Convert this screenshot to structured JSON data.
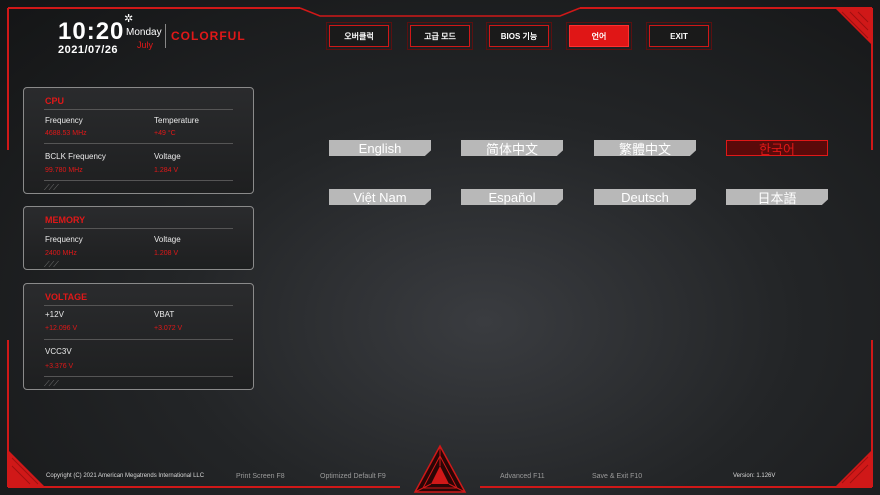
{
  "clock": {
    "time": "10:20",
    "date": "2021/07/26",
    "day": "Monday",
    "month": "July"
  },
  "brand": "COLORFUL",
  "tabs": [
    {
      "label": "오버클럭"
    },
    {
      "label": "고급 모드"
    },
    {
      "label": "BIOS 기능"
    },
    {
      "label": "언어"
    },
    {
      "label": "EXIT"
    }
  ],
  "cpu": {
    "title": "CPU",
    "frequency_label": "Frequency",
    "frequency_value": "4688.53 MHz",
    "temperature_label": "Temperature",
    "temperature_value": "+49 °C",
    "bclk_label": "BCLK Frequency",
    "bclk_value": "99.780 MHz",
    "voltage_label": "Voltage",
    "voltage_value": "1.284 V"
  },
  "memory": {
    "title": "MEMORY",
    "frequency_label": "Frequency",
    "frequency_value": "2400 MHz",
    "voltage_label": "Voltage",
    "voltage_value": "1.208 V"
  },
  "voltage": {
    "title": "VOLTAGE",
    "v12_label": "+12V",
    "v12_value": "+12.096 V",
    "vbat_label": "VBAT",
    "vbat_value": "+3.072 V",
    "vcc3v_label": "VCC3V",
    "vcc3v_value": "+3.376 V"
  },
  "languages": [
    {
      "label": "English"
    },
    {
      "label": "简体中文"
    },
    {
      "label": "繁體中文"
    },
    {
      "label": "한국어"
    },
    {
      "label": "Việt Nam"
    },
    {
      "label": "Español"
    },
    {
      "label": "Deutsch"
    },
    {
      "label": "日本語"
    }
  ],
  "active_language": "한국어",
  "footer": {
    "copyright": "Copyright (C) 2021 American Megatrends International LLC",
    "print_screen": "Print Screen F8",
    "optimized_default": "Optimized Default F9",
    "advanced": "Advanced F11",
    "save_exit": "Save & Exit F10",
    "version": "Version: 1.126V"
  },
  "colors": {
    "accent": "#e01818",
    "panel_border": "#8a8a8a",
    "lang_button": "#b8b8b8"
  },
  "icons": [
    "gear-icon",
    "colorful-triangle-logo"
  ]
}
